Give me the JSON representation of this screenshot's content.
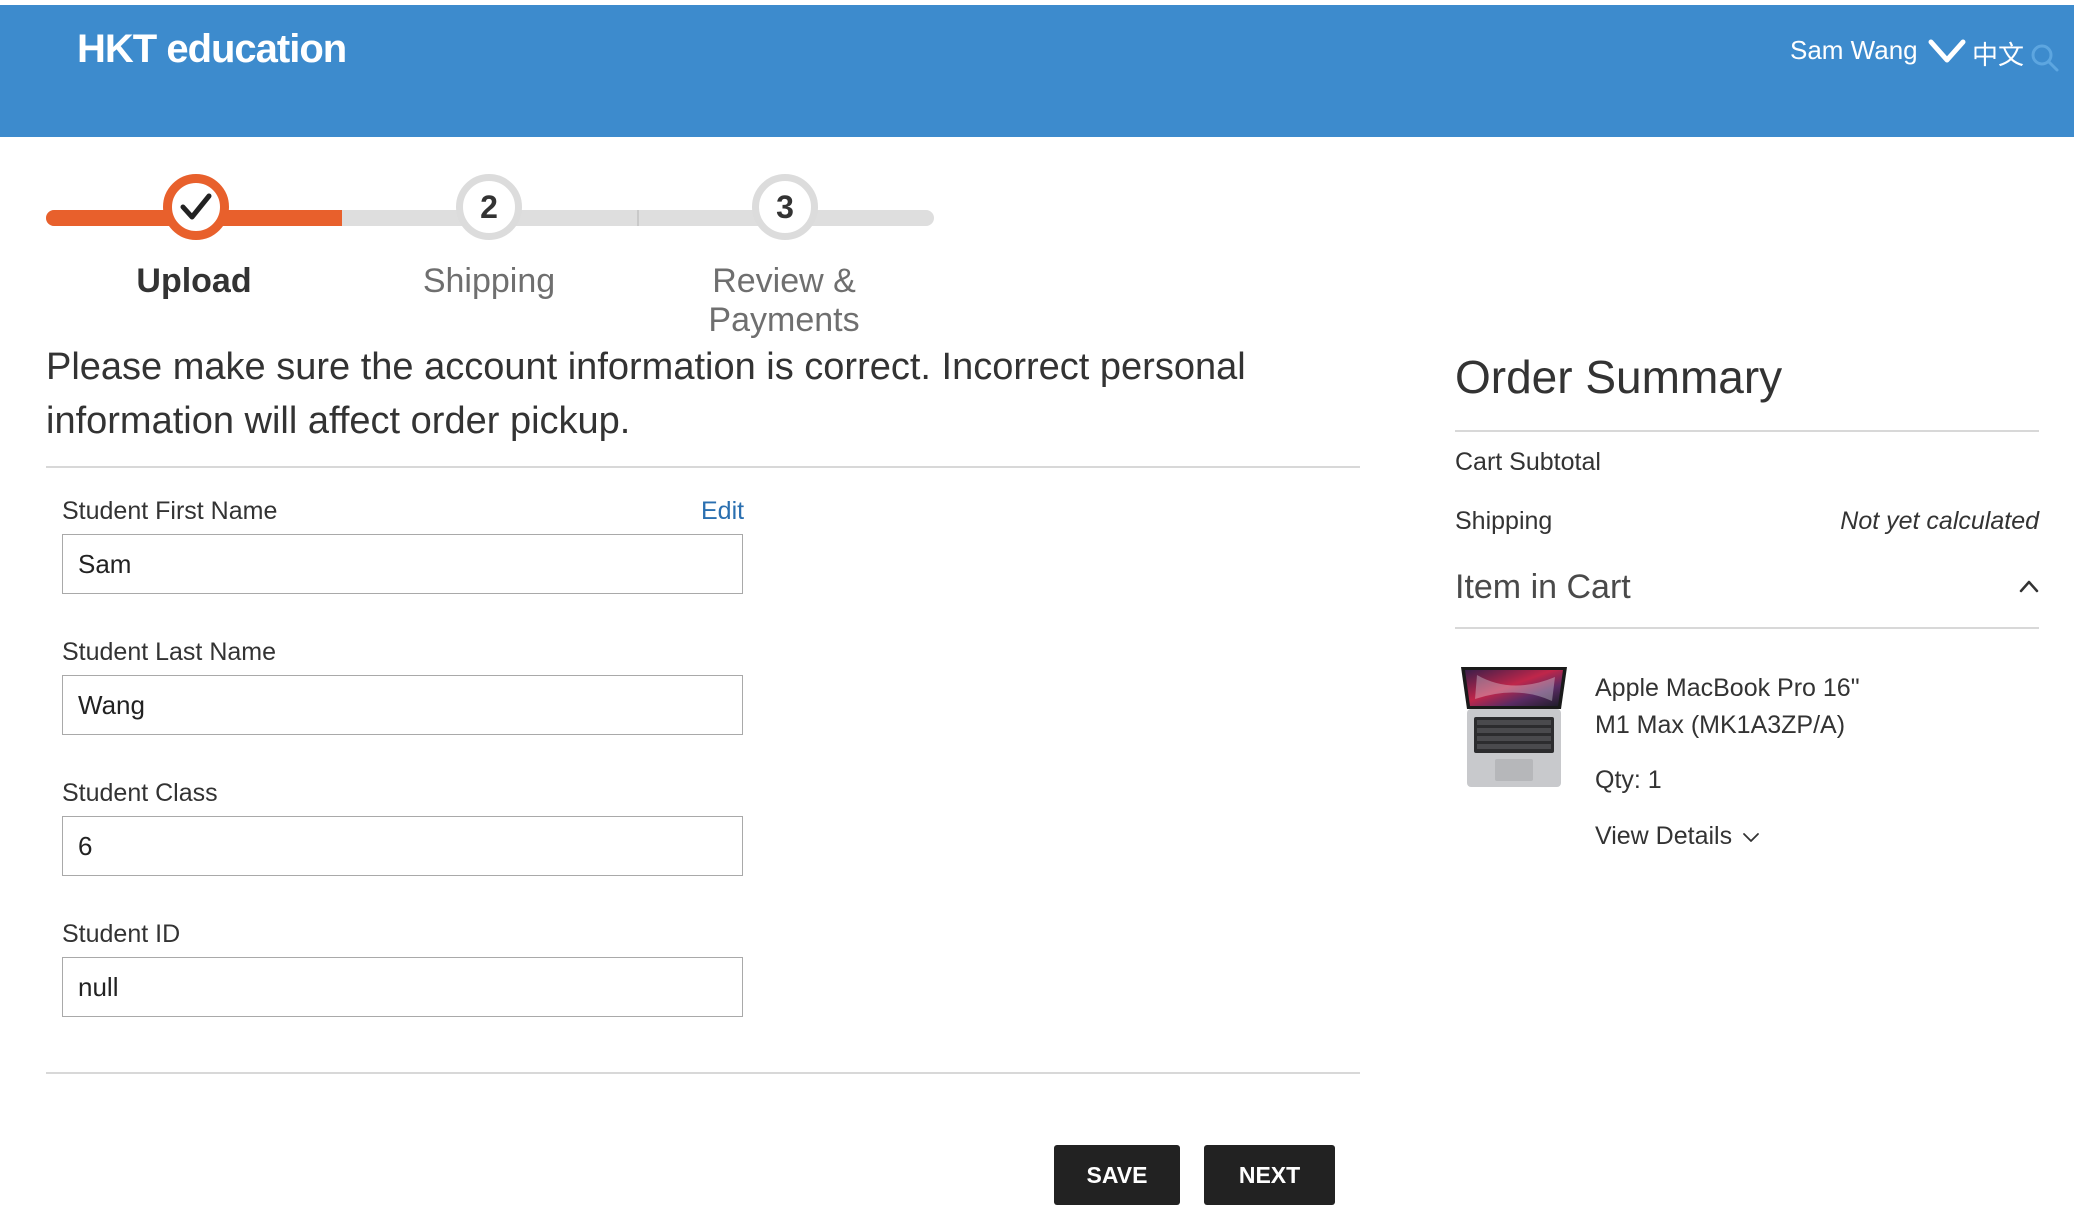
{
  "header": {
    "logo": "HKT education",
    "user_name": "Sam Wang",
    "language_toggle": "中文",
    "search_icon": "search-icon",
    "brand_color": "#3d8bcd"
  },
  "stepper": {
    "accent_color": "#e8602c",
    "steps": [
      {
        "label": "Upload",
        "number": "",
        "status": "completed"
      },
      {
        "label": "Shipping",
        "number": "2",
        "status": "pending"
      },
      {
        "label": "Review & Payments",
        "number": "3",
        "status": "pending"
      }
    ]
  },
  "info_text": "Please make sure the account information is correct. Incorrect personal information will affect order pickup.",
  "form": {
    "edit_label": "Edit",
    "fields": [
      {
        "label": "Student First Name",
        "value": "Sam"
      },
      {
        "label": "Student Last Name",
        "value": "Wang"
      },
      {
        "label": "Student Class",
        "value": "6"
      },
      {
        "label": "Student ID",
        "value": "null"
      }
    ]
  },
  "actions": {
    "save_label": "SAVE",
    "next_label": "NEXT"
  },
  "order_summary": {
    "title": "Order Summary",
    "cart_subtotal_label": "Cart Subtotal",
    "shipping_label": "Shipping",
    "shipping_value": "Not yet calculated",
    "items_heading": "Item in Cart",
    "item": {
      "name_line1": "Apple MacBook Pro 16\"",
      "name_line2": "M1 Max (MK1A3ZP/A)",
      "qty": "Qty: 1",
      "view_details": "View Details"
    }
  }
}
